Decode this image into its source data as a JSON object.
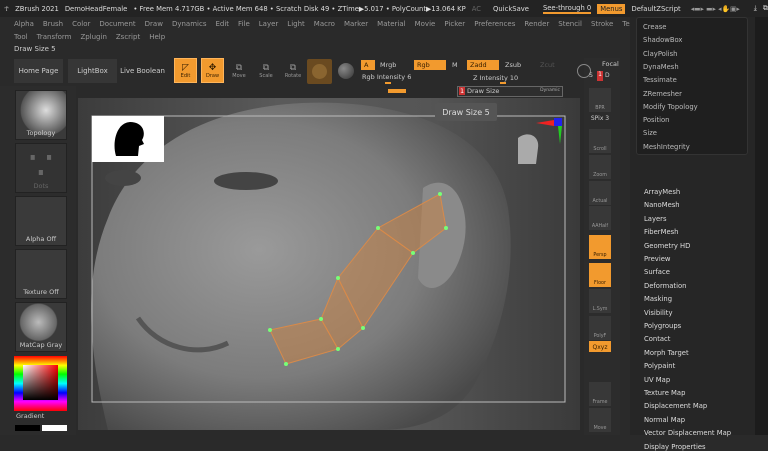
{
  "titlebar": {
    "app": "ZBrush 2021",
    "project": "DemoHeadFemale",
    "stats": "• Free Mem 4.717GB • Active Mem 648 • Scratch Disk 49 • ZTime▶5.017 • PolyCount▶13.064 KP",
    "ac": "AC",
    "quicksave": "QuickSave",
    "seethrough": "See-through  0",
    "menus": "Menus",
    "script": "DefaultZScript"
  },
  "menubar": {
    "row1": [
      "Alpha",
      "Brush",
      "Color",
      "Document",
      "Draw",
      "Dynamics",
      "Edit",
      "File",
      "Layer",
      "Light",
      "Macro",
      "Marker",
      "Material",
      "Movie",
      "Picker",
      "Preferences",
      "Render",
      "Stencil",
      "Stroke",
      "Texture"
    ],
    "row2": [
      "Tool",
      "Transform",
      "Zplugin",
      "Zscript",
      "Help"
    ]
  },
  "status_label": "Draw Size 5",
  "toolbar": {
    "home": "Home Page",
    "lightbox": "LightBox",
    "liveboolean": "Live Boolean",
    "edit": "Edit",
    "draw": "Draw",
    "move": "Move",
    "scale": "Scale",
    "rotate": "Rotate",
    "a": "A",
    "mrgb": "Mrgb",
    "rgb": "Rgb",
    "m": "M",
    "zadd": "Zadd",
    "zsub": "Zsub",
    "zcut": "Zcut",
    "rgb_intensity": "Rgb Intensity 6",
    "z_intensity": "Z Intensity 10",
    "draw_size": "Draw Size",
    "draw_size_value": "1",
    "dynamic": "Dynamic",
    "focal": "Focal",
    "s": "S",
    "d": "D"
  },
  "tooltip": "Draw Size  5",
  "leftpanel": {
    "brush": "Topology",
    "stroke": "Dots",
    "alpha": "Alpha Off",
    "texture": "Texture Off",
    "material": "MatCap Gray",
    "gradient": "Gradient"
  },
  "shelf": [
    "BPR",
    "SPix 3",
    "Scroll",
    "Zoom",
    "Actual",
    "AAHalf",
    "Persp",
    "Floor",
    "L.Sym",
    "PolyF",
    "Qxyz",
    "Frame",
    "Move"
  ],
  "dropdown": [
    "Crease",
    "ShadowBox",
    "ClayPolish",
    "DynaMesh",
    "Tessimate",
    "ZRemesher",
    "Modify Topology",
    "Position",
    "Size",
    "MeshIntegrity"
  ],
  "rightmenu": [
    "ArrayMesh",
    "NanoMesh",
    "Layers",
    "FiberMesh",
    "Geometry HD",
    "Preview",
    "Surface",
    "Deformation",
    "Masking",
    "Visibility",
    "Polygroups",
    "Contact",
    "Morph Target",
    "Polypaint",
    "UV Map",
    "Texture Map",
    "Displacement Map",
    "Normal Map",
    "Vector Displacement Map",
    "Display Properties"
  ],
  "colors": {
    "accent": "#f29a2e",
    "panel": "#2c2c2c",
    "menu": "#262626"
  }
}
